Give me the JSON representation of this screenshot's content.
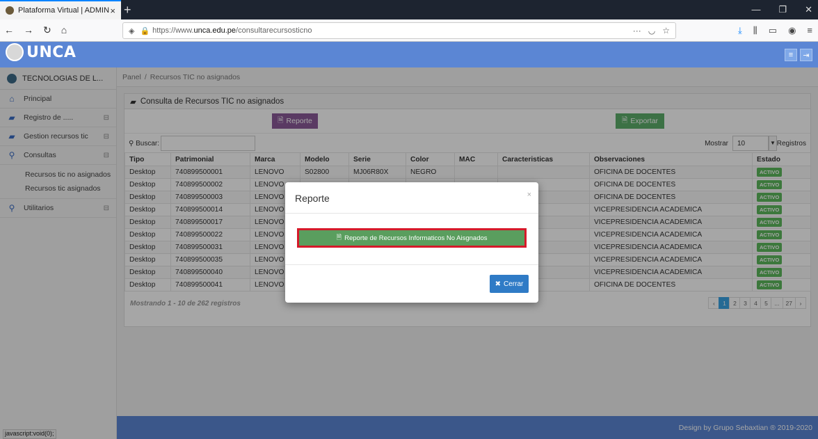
{
  "browser": {
    "tab_title": "Plataforma Virtual | ADMIN",
    "tab_close": "×",
    "new_tab": "+",
    "url_prefix": "https://www.",
    "url_domain": "unca.edu.pe",
    "url_path": "/consultarecursosticno",
    "status_text": "javascript:void(0);"
  },
  "app": {
    "logo_text": "UNCA",
    "header_color": "#5b86d4"
  },
  "sidebar": {
    "user_label": "TECNOLOGIAS DE L...",
    "items": [
      {
        "label": "Principal",
        "icon": "home-icon"
      },
      {
        "label": "Registro de .....",
        "icon": "book-icon"
      },
      {
        "label": "Gestion recursos tic",
        "icon": "book-icon"
      },
      {
        "label": "Consultas",
        "icon": "search-icon"
      },
      {
        "label": "Utilitarios",
        "icon": "search-icon"
      }
    ],
    "subitems": [
      "Recursos tic no asignados",
      "Recursos tic asignados"
    ]
  },
  "breadcrumb": {
    "root": "Panel",
    "sep": "/",
    "current": "Recursos TIC no asignados"
  },
  "panel": {
    "title": "Consulta de Recursos TIC no asignados",
    "btn_reporte": "Reporte",
    "btn_exportar": "Exportar",
    "search_label": "Buscar:",
    "mostrar_label": "Mostrar",
    "mostrar_value": "10",
    "registros_label": "Registros"
  },
  "table": {
    "headers": [
      "Tipo",
      "Patrimonial",
      "Marca",
      "Modelo",
      "Serie",
      "Color",
      "MAC",
      "Caracteristicas",
      "Observaciones",
      "Estado"
    ],
    "rows": [
      [
        "Desktop",
        "740899500001",
        "LENOVO",
        "S02800",
        "MJ06R80X",
        "NEGRO",
        "",
        "",
        "OFICINA DE DOCENTES",
        "ACTIVO"
      ],
      [
        "Desktop",
        "740899500002",
        "LENOVO",
        "",
        "",
        "",
        "",
        "",
        "OFICINA DE DOCENTES",
        "ACTIVO"
      ],
      [
        "Desktop",
        "740899500003",
        "LENOVO",
        "",
        "",
        "",
        "",
        "",
        "OFICINA DE DOCENTES",
        "ACTIVO"
      ],
      [
        "Desktop",
        "740899500014",
        "LENOVO",
        "",
        "",
        "",
        "",
        "",
        "VICEPRESIDENCIA ACADEMICA",
        "ACTIVO"
      ],
      [
        "Desktop",
        "740899500017",
        "LENOVO",
        "",
        "",
        "",
        "",
        "",
        "VICEPRESIDENCIA ACADEMICA",
        "ACTIVO"
      ],
      [
        "Desktop",
        "740899500022",
        "LENOVO",
        "",
        "",
        "",
        "",
        "",
        "VICEPRESIDENCIA ACADEMICA",
        "ACTIVO"
      ],
      [
        "Desktop",
        "740899500031",
        "LENOVO",
        "",
        "",
        "",
        "",
        "",
        "VICEPRESIDENCIA ACADEMICA",
        "ACTIVO"
      ],
      [
        "Desktop",
        "740899500035",
        "LENOVO",
        "",
        "",
        "",
        "",
        "",
        "VICEPRESIDENCIA ACADEMICA",
        "ACTIVO"
      ],
      [
        "Desktop",
        "740899500040",
        "LENOVO",
        "",
        "",
        "",
        "",
        "",
        "VICEPRESIDENCIA ACADEMICA",
        "ACTIVO"
      ],
      [
        "Desktop",
        "740899500041",
        "LENOVO",
        "",
        "",
        "",
        "",
        "",
        "OFICINA DE DOCENTES",
        "ACTIVO"
      ]
    ],
    "info": "Mostrando 1 - 10 de 262 registros",
    "pages": [
      "‹",
      "1",
      "2",
      "3",
      "4",
      "5",
      "...",
      "27",
      "›"
    ],
    "active_page": "1"
  },
  "footer": {
    "text": "Design by Grupo Sebaxtian ® 2019-2020"
  },
  "modal": {
    "title": "Reporte",
    "close": "×",
    "report_button": "Reporte de Recursos Informaticos No Aisgnados",
    "cerrar_button": "Cerrar"
  }
}
